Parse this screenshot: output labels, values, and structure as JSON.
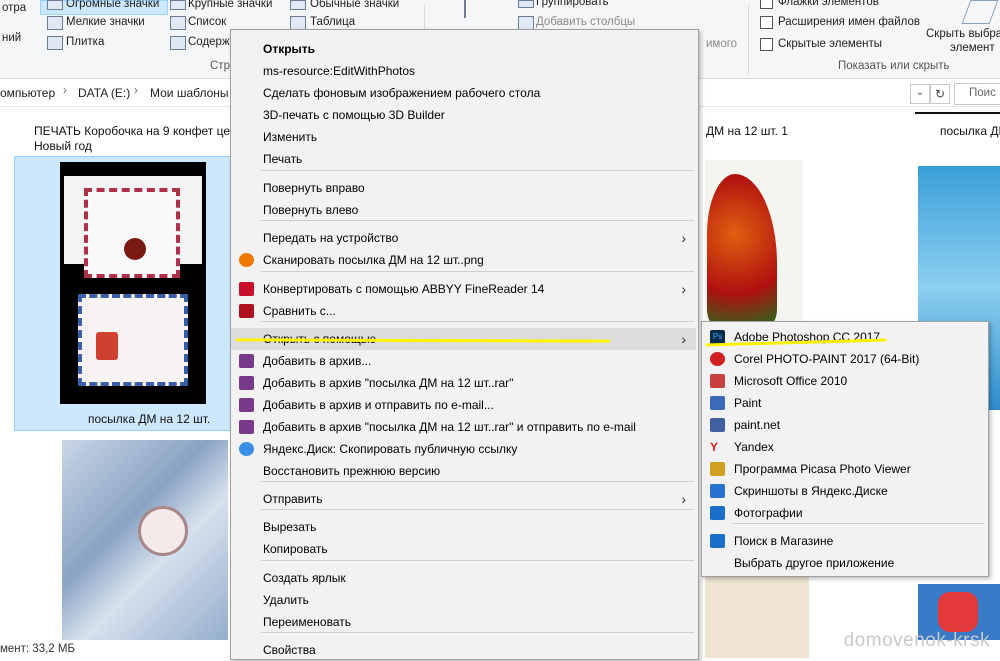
{
  "ribbon": {
    "view_items": [
      "Огромные значки",
      "Крупные значки",
      "Обычные значки",
      "Мелкие значки",
      "Список",
      "Таблица",
      "Плитка",
      "Содерж"
    ],
    "left_labels": [
      "отра",
      "ний"
    ],
    "group_layout_label": "Стр",
    "sort_items": [
      "Группировать",
      "Добавить столбцы",
      "имого"
    ],
    "show_items": [
      "Флажки элементов",
      "Расширения имен файлов",
      "Скрытые элементы"
    ],
    "show_group_label": "Показать или скрыть",
    "hide_selected": [
      "Скрыть выбра",
      "элемент"
    ]
  },
  "address": {
    "crumbs": [
      "омпьютер",
      "DATA (E:)",
      "Мои шаблоны"
    ],
    "search_placeholder": "Поис"
  },
  "files": {
    "folder_label_1": "ПЕЧАТЬ Коробочка на 9 конфет це",
    "folder_label_1b": "Новый год",
    "folder_label_2": "ДМ на 12 шт. 1",
    "folder_label_3": "посылка ДМ",
    "selected_file": "посылка ДМ на 12 шт."
  },
  "context_menu": {
    "items": [
      {
        "label": "Открыть",
        "bold": true
      },
      {
        "label": "ms-resource:EditWithPhotos"
      },
      {
        "label": "Сделать фоновым изображением рабочего стола"
      },
      {
        "label": "3D-печать с помощью 3D Builder"
      },
      {
        "label": "Изменить"
      },
      {
        "label": "Печать"
      },
      {
        "label": "Повернуть вправо"
      },
      {
        "label": "Повернуть влево"
      },
      {
        "label": "Передать на устройство"
      },
      {
        "label": "Сканировать посылка ДМ на 12 шт..png"
      },
      {
        "label": "Конвертировать с помощью ABBYY FineReader 14"
      },
      {
        "label": "Сравнить с..."
      },
      {
        "label": "Открыть с помощью"
      },
      {
        "label": "Добавить в архив..."
      },
      {
        "label": "Добавить в архив \"посылка ДМ на 12 шт..rar\""
      },
      {
        "label": "Добавить в архив и отправить по e-mail..."
      },
      {
        "label": "Добавить в архив \"посылка ДМ на 12 шт..rar\" и отправить по e-mail"
      },
      {
        "label": "Яндекс.Диск: Скопировать публичную ссылку"
      },
      {
        "label": "Восстановить прежнюю версию"
      },
      {
        "label": "Отправить"
      },
      {
        "label": "Вырезать"
      },
      {
        "label": "Копировать"
      },
      {
        "label": "Создать ярлык"
      },
      {
        "label": "Удалить"
      },
      {
        "label": "Переименовать"
      },
      {
        "label": "Свойства"
      }
    ]
  },
  "submenu": {
    "items": [
      {
        "label": "Adobe Photoshop CC 2017",
        "icon": "photoshop-icon"
      },
      {
        "label": "Corel PHOTO-PAINT 2017 (64-Bit)",
        "icon": "corel-icon"
      },
      {
        "label": "Microsoft Office 2010",
        "icon": "office-picture-icon"
      },
      {
        "label": "Paint",
        "icon": "paint-icon"
      },
      {
        "label": "paint.net",
        "icon": "paintnet-icon"
      },
      {
        "label": "Yandex",
        "icon": "yandex-icon"
      },
      {
        "label": "Программа Picasa Photo Viewer",
        "icon": "picasa-icon"
      },
      {
        "label": "Скриншоты в Яндекс.Диске",
        "icon": "yandex-disk-screenshot-icon"
      },
      {
        "label": "Фотографии",
        "icon": "photos-icon"
      },
      {
        "label": "Поиск в Магазине",
        "icon": "store-icon"
      },
      {
        "label": "Выбрать другое приложение",
        "icon": ""
      }
    ]
  },
  "status": "мент: 33,2 МБ",
  "watermark": "domovenok-krsk",
  "colors": {
    "highlight": "#fff200",
    "menu_bg": "#f2f2f2",
    "selection": "#cce8ff"
  }
}
